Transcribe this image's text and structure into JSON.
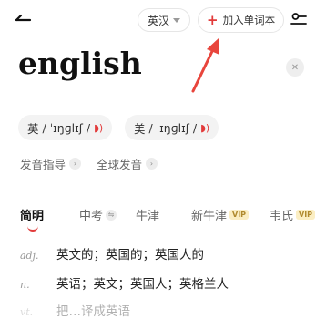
{
  "header": {
    "dict_label": "英汉",
    "add_label": "加入单词本"
  },
  "word": "english",
  "pronunciations": [
    {
      "region": "英",
      "ipa": " / ˈɪŋɡlɪʃ / "
    },
    {
      "region": "美",
      "ipa": " / ˈɪŋɡlɪʃ / "
    }
  ],
  "links": {
    "guide": "发音指导",
    "global": "全球发音"
  },
  "tabs": [
    {
      "label": "简明"
    },
    {
      "label": "中考"
    },
    {
      "label": "牛津"
    },
    {
      "label": "新牛津",
      "badge": "VIP"
    },
    {
      "label": "韦氏",
      "badge": "VIP"
    }
  ],
  "definitions": [
    {
      "pos": "adj.",
      "text": "英文的；英国的；英国人的"
    },
    {
      "pos": "n.",
      "text": "英语；英文；英国人；英格兰人"
    },
    {
      "pos": "vt.",
      "text": "把…译成英语"
    }
  ],
  "colors": {
    "accent": "#e23b3b",
    "vip_bg": "#fbeec3",
    "vip_text": "#b08a2e"
  },
  "icons": {
    "back": "back-arrow-icon",
    "dropdown": "caret-down-icon",
    "add": "plus-icon",
    "settings": "settings-sliders-icon",
    "clear": "close-icon",
    "speaker": "speaker-icon",
    "chevron": "chevron-right-icon",
    "swap": "swap-icon"
  }
}
